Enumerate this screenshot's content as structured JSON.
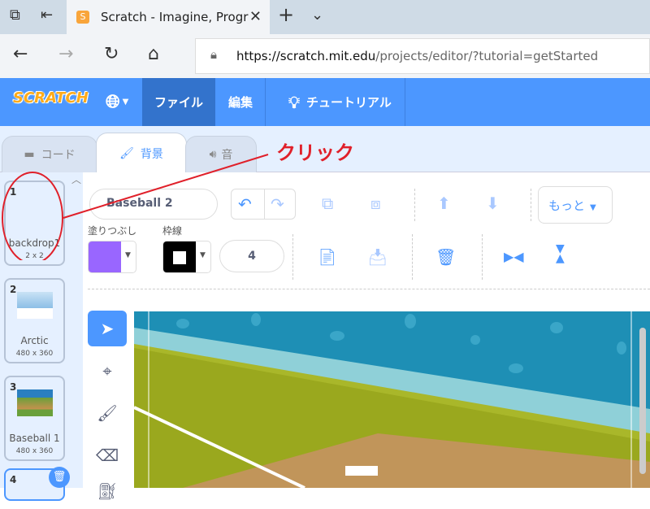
{
  "browser": {
    "tab_title": "Scratch - Imagine, Progr",
    "url_host": "https://scratch.mit.edu",
    "url_path": "/projects/editor/?tutorial=getStarted",
    "new_tab": "+",
    "icons": [
      "tabs-icon",
      "back-tabs-icon",
      "close-icon",
      "back-icon",
      "forward-icon",
      "refresh-icon",
      "home-icon",
      "lock-icon",
      "chevron-down-icon"
    ]
  },
  "menubar": {
    "logo": "SCRATCH",
    "file": "ファイル",
    "edit": "編集",
    "tutorial": "チュートリアル",
    "accent": "#4c97ff"
  },
  "editor_tabs": [
    {
      "label": "コード"
    },
    {
      "label": "背景"
    },
    {
      "label": "音"
    }
  ],
  "annotation": {
    "text": "クリック",
    "color": "#e0202a"
  },
  "backdrops": [
    {
      "num": "1",
      "name": "backdrop1",
      "size": "2 x 2"
    },
    {
      "num": "2",
      "name": "Arctic",
      "size": "480 x 360"
    },
    {
      "num": "3",
      "name": "Baseball 1",
      "size": "480 x 360"
    },
    {
      "num": "4",
      "name": "",
      "size": ""
    }
  ],
  "paint": {
    "costume_name": "Baseball 2",
    "fill_label": "塗りつぶし",
    "outline_label": "枠線",
    "fill_color": "#9966ff",
    "outline_color": "#000000",
    "outline_width": "4",
    "more": "もっと"
  }
}
